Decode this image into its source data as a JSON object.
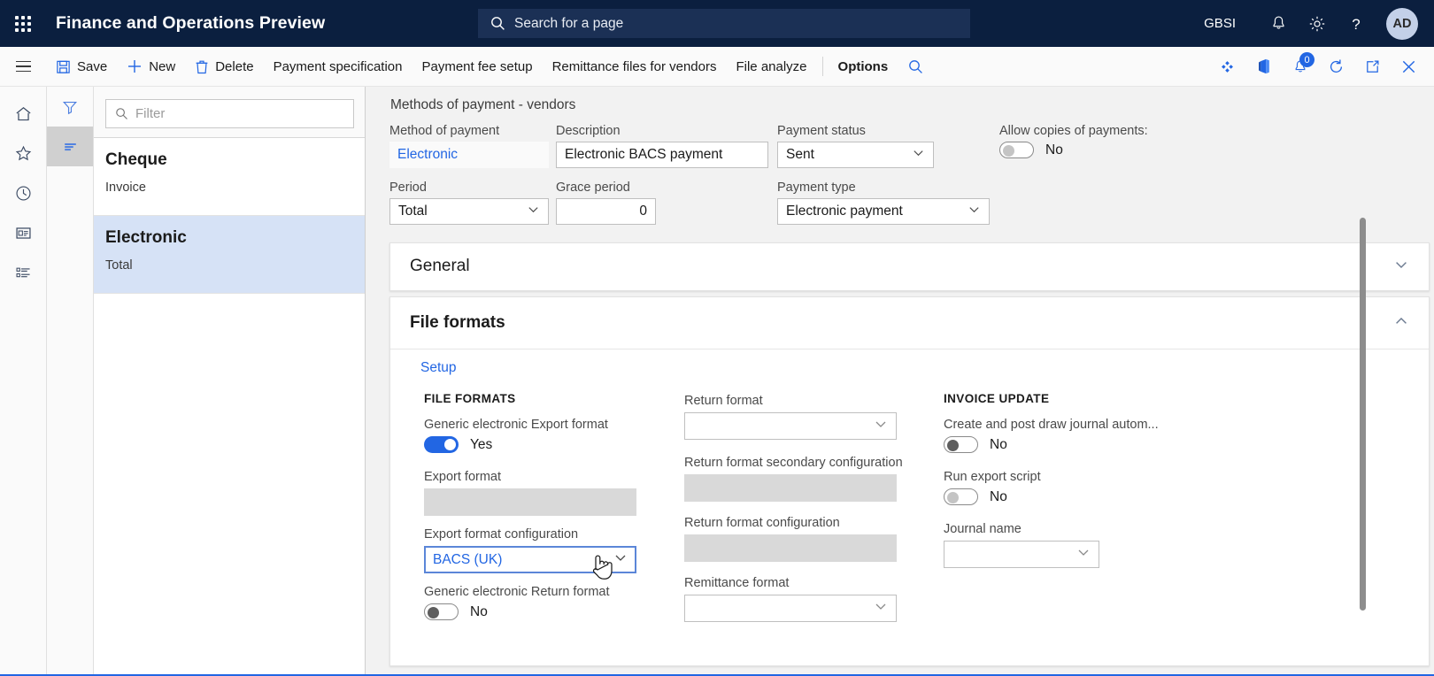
{
  "topnav": {
    "app_title": "Finance and Operations Preview",
    "waffle_name": "app-launcher",
    "search_placeholder": "Search for a page",
    "company": "GBSI",
    "avatar_initials": "AD",
    "icons": [
      "bell-icon",
      "gear-icon",
      "help-icon"
    ]
  },
  "commandbar": {
    "items": [
      {
        "label": "Save",
        "icon": "save-icon"
      },
      {
        "label": "New",
        "icon": "plus-icon"
      },
      {
        "label": "Delete",
        "icon": "trash-icon"
      },
      {
        "label": "Payment specification",
        "icon": ""
      },
      {
        "label": "Payment fee setup",
        "icon": ""
      },
      {
        "label": "Remittance files for vendors",
        "icon": ""
      },
      {
        "label": "File analyze",
        "icon": ""
      },
      {
        "label": "Options",
        "icon": ""
      }
    ],
    "search_icon": "search-icon",
    "right_icons": [
      "attachments-icon",
      "office-app-icon",
      "notifications-icon",
      "refresh-icon",
      "popout-icon",
      "close-icon"
    ],
    "notification_count": "0"
  },
  "leftrail": {
    "items": [
      "home-icon",
      "favorites-star-icon",
      "recent-clock-icon",
      "workspaces-icon",
      "modules-list-icon"
    ]
  },
  "filterrail": {
    "filter_icon": "filter-icon",
    "list_icon": "list-view-icon"
  },
  "listpanel": {
    "filter_placeholder": "Filter",
    "filter_icon": "search-icon",
    "rows": [
      {
        "title": "Cheque",
        "subtitle": "Invoice",
        "selected": false
      },
      {
        "title": "Electronic",
        "subtitle": "Total",
        "selected": true
      }
    ]
  },
  "page": {
    "caption": "Methods of payment - vendors"
  },
  "header_fields": {
    "method_of_payment": {
      "label": "Method of payment",
      "value": "Electronic"
    },
    "description": {
      "label": "Description",
      "value": "Electronic BACS payment"
    },
    "payment_status": {
      "label": "Payment status",
      "value": "Sent"
    },
    "allow_copies": {
      "label": "Allow copies of payments:",
      "value": "No",
      "state": "off"
    },
    "period": {
      "label": "Period",
      "value": "Total"
    },
    "grace_period": {
      "label": "Grace period",
      "value": "0"
    },
    "payment_type": {
      "label": "Payment type",
      "value": "Electronic payment"
    }
  },
  "sections": {
    "general": {
      "title": "General",
      "expanded": false
    },
    "file_formats": {
      "title": "File formats",
      "expanded": true,
      "tab_label": "Setup",
      "col1": {
        "heading": "FILE FORMATS",
        "generic_export": {
          "label": "Generic electronic Export format",
          "value": "Yes",
          "state": "on"
        },
        "export_format": {
          "label": "Export format",
          "value": ""
        },
        "export_format_configuration": {
          "label": "Export format configuration",
          "value": "BACS (UK)"
        },
        "generic_return": {
          "label": "Generic electronic Return format",
          "value": "No",
          "state": "off"
        }
      },
      "col2": {
        "return_format": {
          "label": "Return format",
          "value": ""
        },
        "return_format_secondary_configuration": {
          "label": "Return format secondary configuration",
          "value": ""
        },
        "return_format_configuration": {
          "label": "Return format configuration",
          "value": ""
        },
        "remittance_format": {
          "label": "Remittance format",
          "value": ""
        }
      },
      "col3": {
        "heading": "INVOICE UPDATE",
        "create_post_draw_journal": {
          "label": "Create and post draw journal autom...",
          "value": "No",
          "state": "off"
        },
        "run_export_script": {
          "label": "Run export script",
          "value": "No",
          "state": "off"
        },
        "journal_name": {
          "label": "Journal name",
          "value": ""
        }
      }
    }
  },
  "colors": {
    "nav_bg": "#0b1f3f",
    "accent": "#2266e3",
    "selected_row": "#d6e2f6",
    "disabled_field": "#d9d9d9"
  }
}
